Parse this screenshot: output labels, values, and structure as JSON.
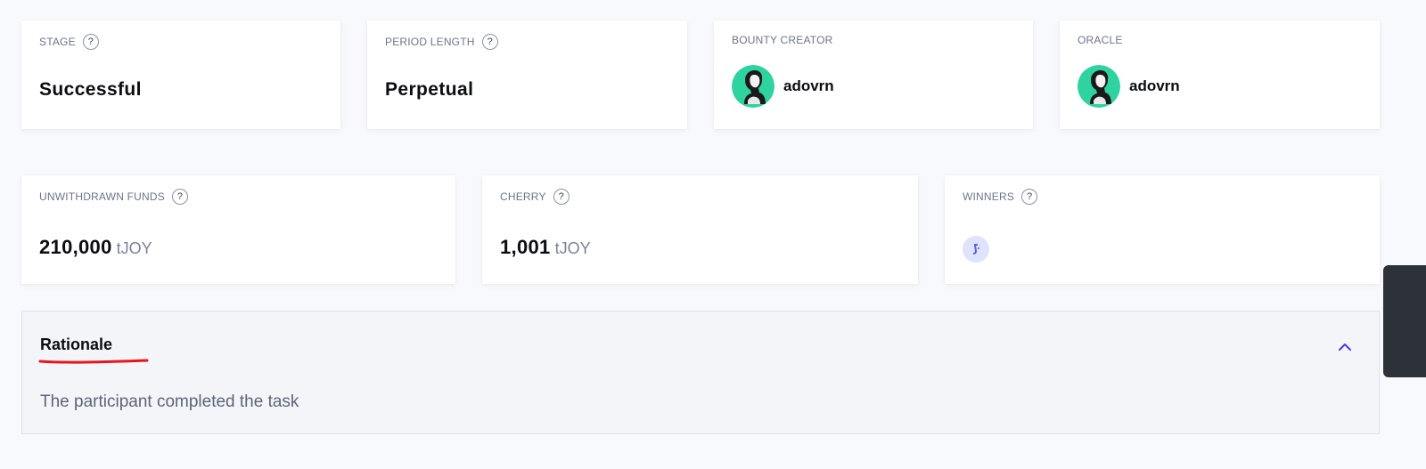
{
  "cards_row1": [
    {
      "label": "STAGE",
      "value": "Successful"
    },
    {
      "label": "PERIOD LENGTH",
      "value": "Perpetual"
    },
    {
      "label": "BOUNTY CREATOR",
      "member": "adovrn"
    },
    {
      "label": "ORACLE",
      "member": "adovrn"
    }
  ],
  "cards_row2": [
    {
      "label": "UNWITHDRAWN FUNDS",
      "amount": "210,000",
      "unit": "tJOY"
    },
    {
      "label": "CHERRY",
      "amount": "1,001",
      "unit": "tJOY"
    },
    {
      "label": "WINNERS"
    }
  ],
  "help_glyph": "?",
  "rationale": {
    "title": "Rationale",
    "text": "The participant completed the task"
  },
  "colors": {
    "avatar_bg": "#2fd3a0",
    "annotation_underline": "#e8141c",
    "chevron": "#4038ff",
    "winner_icon_bg": "#dfe3fb",
    "winner_icon_fg": "#5561e6"
  },
  "icons": {
    "help": "question-circle-icon",
    "avatar": "member-avatar",
    "winner": "member-icon",
    "collapse": "chevron-up-icon"
  }
}
